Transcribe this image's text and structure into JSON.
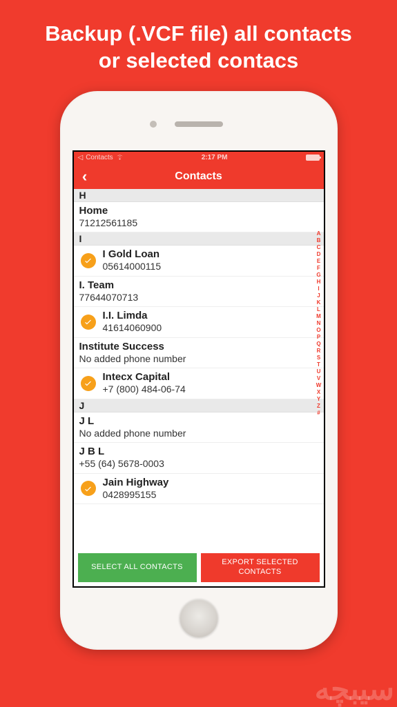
{
  "promo": {
    "line1": "Backup (.VCF file) all contacts",
    "line2": "or selected contacs"
  },
  "status_bar": {
    "back_app": "Contacts",
    "time": "2:17 PM"
  },
  "nav": {
    "title": "Contacts"
  },
  "sections": [
    {
      "letter": "H",
      "rows": [
        {
          "selected": false,
          "name": "Home",
          "detail": "71212561185"
        }
      ]
    },
    {
      "letter": "I",
      "rows": [
        {
          "selected": true,
          "name": "I Gold Loan",
          "detail": "05614000115"
        },
        {
          "selected": false,
          "name": "I. Team",
          "detail": "77644070713"
        },
        {
          "selected": true,
          "name": "I.I. Limda",
          "detail": "41614060900"
        },
        {
          "selected": false,
          "name": "Institute Success",
          "detail": "No added phone number"
        },
        {
          "selected": true,
          "name": "Intecx Capital",
          "detail": "+7 (800) 484-06-74"
        }
      ]
    },
    {
      "letter": "J",
      "rows": [
        {
          "selected": false,
          "name": "J L",
          "detail": "No added phone number"
        },
        {
          "selected": false,
          "name": "J B L",
          "detail": "+55 (64) 5678-0003"
        },
        {
          "selected": true,
          "name": "Jain Highway",
          "detail": "0428995155"
        }
      ]
    }
  ],
  "index_letters": [
    "A",
    "B",
    "C",
    "D",
    "E",
    "F",
    "G",
    "H",
    "I",
    "J",
    "K",
    "L",
    "M",
    "N",
    "O",
    "P",
    "Q",
    "R",
    "S",
    "T",
    "U",
    "V",
    "W",
    "X",
    "Y",
    "Z",
    "#"
  ],
  "buttons": {
    "select_all": "SELECT ALL CONTACTS",
    "export_line1": "EXPORT SELECTED",
    "export_line2": "CONTACTS"
  },
  "watermark": "سیبچه"
}
